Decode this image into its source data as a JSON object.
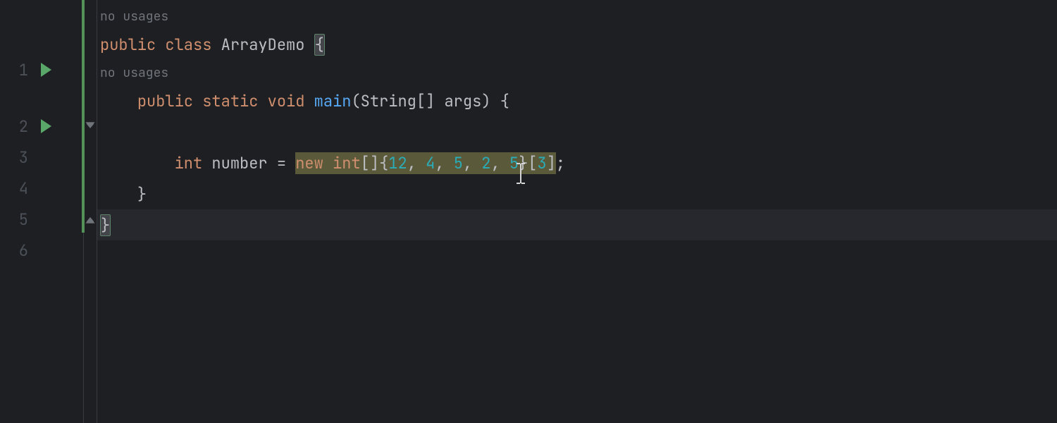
{
  "hints": {
    "class_usages": "no usages",
    "method_usages": "no usages"
  },
  "gutter": {
    "line_numbers": [
      "1",
      "2",
      "3",
      "4",
      "5",
      "6"
    ]
  },
  "code": {
    "line1": {
      "kw_public": "public",
      "kw_class": "class",
      "class_name": "ArrayDemo",
      "brace_open": "{"
    },
    "line2": {
      "kw_public": "public",
      "kw_static": "static",
      "kw_void": "void",
      "method_name": "main",
      "param_type": "String",
      "brackets": "[]",
      "param_name": "args",
      "brace_open": "{"
    },
    "line4": {
      "kw_int": "int",
      "var_name": "number",
      "eq": "=",
      "kw_new": "new",
      "kw_int2": "int",
      "arr_brackets": "[]",
      "arr_open": "{",
      "v1": "12",
      "c": ",",
      "v2": "4",
      "v3": "5",
      "v4": "2",
      "v5": "5",
      "arr_close": "}",
      "idx_open": "[",
      "idx": "3",
      "idx_close": "]",
      "semi": ";"
    },
    "line5": {
      "brace_close": "}"
    },
    "line6": {
      "brace_close": "}"
    }
  },
  "colors": {
    "keyword": "#cf8e6d",
    "number": "#2aacb8",
    "method": "#56a8f5",
    "background": "#1e1f22",
    "highlight": "#5a5a3b"
  }
}
